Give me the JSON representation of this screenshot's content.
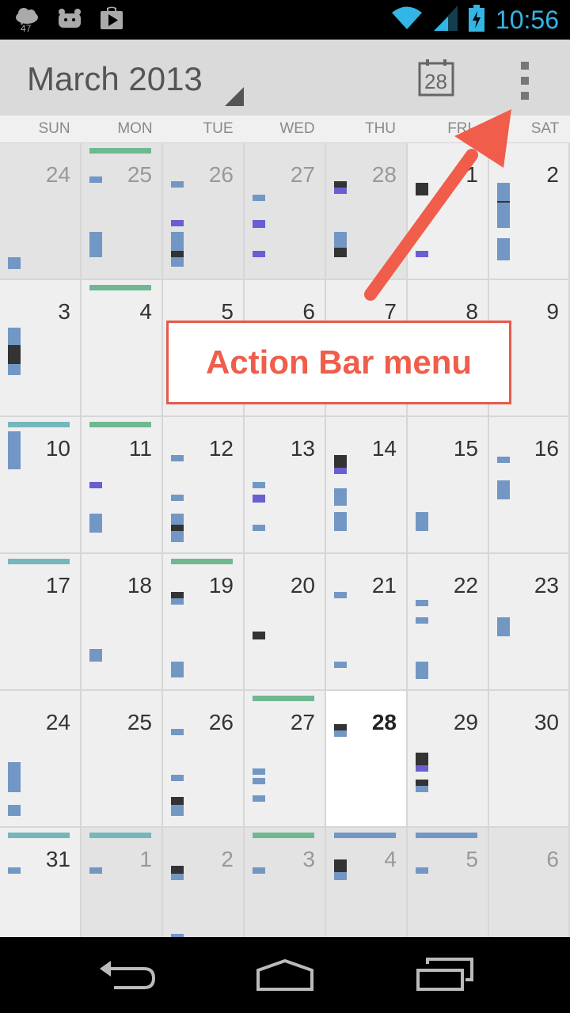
{
  "status_bar": {
    "weather_temp": "47",
    "time": "10:56"
  },
  "action_bar": {
    "title": "March 2013",
    "today_icon_day": "28"
  },
  "days_of_week": [
    "SUN",
    "MON",
    "TUE",
    "WED",
    "THU",
    "FRI",
    "SAT"
  ],
  "weeks": [
    [
      "24",
      "25",
      "26",
      "27",
      "28",
      "1",
      "2"
    ],
    [
      "3",
      "4",
      "5",
      "6",
      "7",
      "8",
      "9"
    ],
    [
      "10",
      "11",
      "12",
      "13",
      "14",
      "15",
      "16"
    ],
    [
      "17",
      "18",
      "19",
      "20",
      "21",
      "22",
      "23"
    ],
    [
      "24",
      "25",
      "26",
      "27",
      "28",
      "29",
      "30"
    ],
    [
      "31",
      "1",
      "2",
      "3",
      "4",
      "5",
      "6"
    ]
  ],
  "callout": {
    "text": "Action Bar menu"
  },
  "colors": {
    "event_blue": "#7397c4",
    "event_purple": "#6a5fd0",
    "event_dark": "#333333",
    "allday_green": "#6fb891",
    "allday_teal": "#74b7bd",
    "allday_blue": "#7397c4",
    "callout_red": "#f05d4a",
    "clock_blue": "#33b5e5"
  }
}
